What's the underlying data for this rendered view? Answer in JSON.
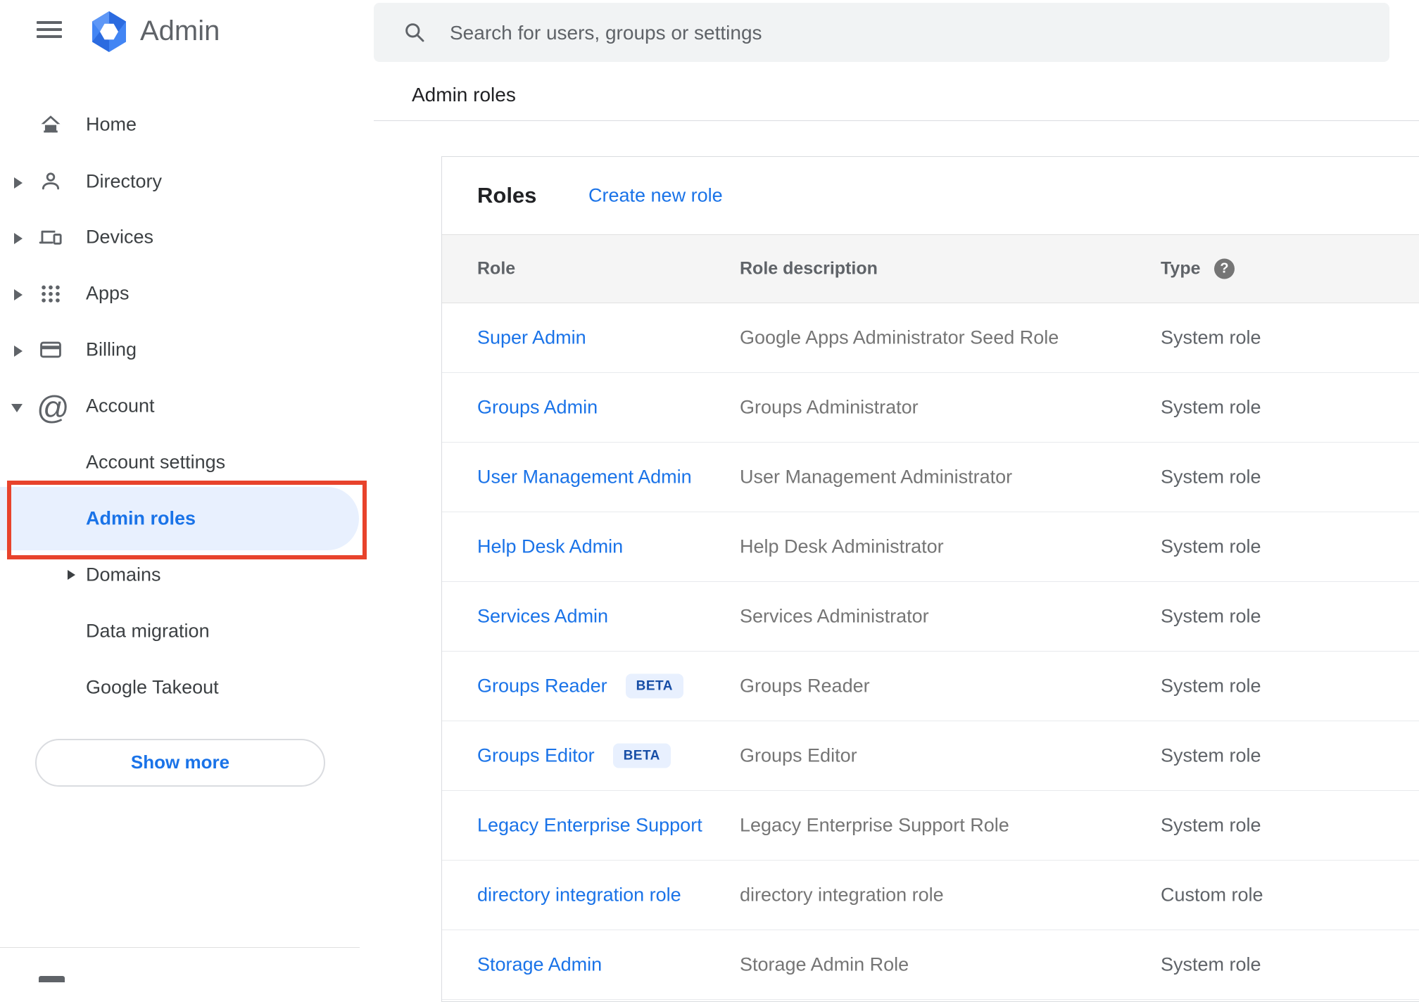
{
  "header": {
    "app_title": "Admin",
    "search_placeholder": "Search for users, groups or settings"
  },
  "breadcrumb": {
    "label": "Admin roles"
  },
  "sidebar": {
    "items": [
      {
        "label": "Home"
      },
      {
        "label": "Directory"
      },
      {
        "label": "Devices"
      },
      {
        "label": "Apps"
      },
      {
        "label": "Billing"
      },
      {
        "label": "Account"
      }
    ],
    "account_children": [
      {
        "label": "Account settings"
      },
      {
        "label": "Admin roles",
        "selected": true
      },
      {
        "label": "Domains"
      },
      {
        "label": "Data migration"
      },
      {
        "label": "Google Takeout"
      }
    ],
    "show_more_label": "Show more"
  },
  "main": {
    "card_title": "Roles",
    "create_link": "Create new role",
    "table": {
      "columns": [
        "Role",
        "Role description",
        "Type"
      ],
      "beta_label": "BETA",
      "rows": [
        {
          "role": "Super Admin",
          "description": "Google Apps Administrator Seed Role",
          "type": "System role"
        },
        {
          "role": "Groups Admin",
          "description": "Groups Administrator",
          "type": "System role"
        },
        {
          "role": "User Management Admin",
          "description": "User Management Administrator",
          "type": "System role"
        },
        {
          "role": "Help Desk Admin",
          "description": "Help Desk Administrator",
          "type": "System role"
        },
        {
          "role": "Services Admin",
          "description": "Services Administrator",
          "type": "System role"
        },
        {
          "role": "Groups Reader",
          "beta": true,
          "description": "Groups Reader",
          "type": "System role"
        },
        {
          "role": "Groups Editor",
          "beta": true,
          "description": "Groups Editor",
          "type": "System role"
        },
        {
          "role": "Legacy Enterprise Support",
          "description": "Legacy Enterprise Support Role",
          "type": "System role"
        },
        {
          "role": "directory integration role",
          "description": "directory integration role",
          "type": "Custom role"
        },
        {
          "role": "Storage Admin",
          "description": "Storage Admin Role",
          "type": "System role"
        }
      ]
    }
  },
  "colors": {
    "link_blue": "#1a73e8",
    "selected_bg": "#e8f0fe",
    "annotation_red": "#e8432c",
    "beta_bg": "#e8f0fe",
    "beta_text": "#174ea6",
    "header_row_bg": "#f5f5f5"
  }
}
